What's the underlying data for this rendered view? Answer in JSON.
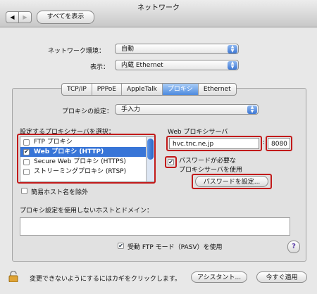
{
  "window": {
    "title": "ネットワーク"
  },
  "toolbar": {
    "back": "◀",
    "forward": "▶",
    "show_all": "すべてを表示"
  },
  "location": {
    "label": "ネットワーク環境：",
    "value": "自動"
  },
  "show": {
    "label": "表示：",
    "value": "内蔵 Ethernet"
  },
  "tabs": [
    "TCP/IP",
    "PPPoE",
    "AppleTalk",
    "プロキシ",
    "Ethernet"
  ],
  "active_tab": "プロキシ",
  "proxy_config": {
    "label": "プロキシの設定：",
    "value": "手入力"
  },
  "proxy_list": {
    "label": "設定するプロキシサーバを選択：",
    "items": [
      {
        "label": "FTP プロキシ",
        "checked": false,
        "selected": false
      },
      {
        "label": "Web プロキシ (HTTP)",
        "checked": true,
        "selected": true
      },
      {
        "label": "Secure Web プロキシ (HTTPS)",
        "checked": false,
        "selected": false
      },
      {
        "label": "ストリーミングプロキシ (RTSP)",
        "checked": false,
        "selected": false
      }
    ]
  },
  "web_proxy": {
    "label": "Web プロキシサーバ",
    "server": "hvc.tnc.ne.jp",
    "separator": ":",
    "port": "8080"
  },
  "password": {
    "label_line1": "パスワードが必要な",
    "label_line2": "プロキシサーバを使用",
    "checked": true,
    "button": "パスワードを設定..."
  },
  "simple_hosts": {
    "label": "簡易ホスト名を除外",
    "checked": false
  },
  "bypass": {
    "label": "プロキシ設定を使用しないホストとドメイン：",
    "value": ""
  },
  "pasv": {
    "label": "受動 FTP モード（PASV）を使用",
    "checked": true
  },
  "help": "?",
  "footer": {
    "lock_text": "変更できないようにするにはカギをクリックします。",
    "assistant": "アシスタント...",
    "apply": "今すぐ適用"
  },
  "colors": {
    "highlight": "#c21a1a",
    "selection": "#3875d7"
  }
}
